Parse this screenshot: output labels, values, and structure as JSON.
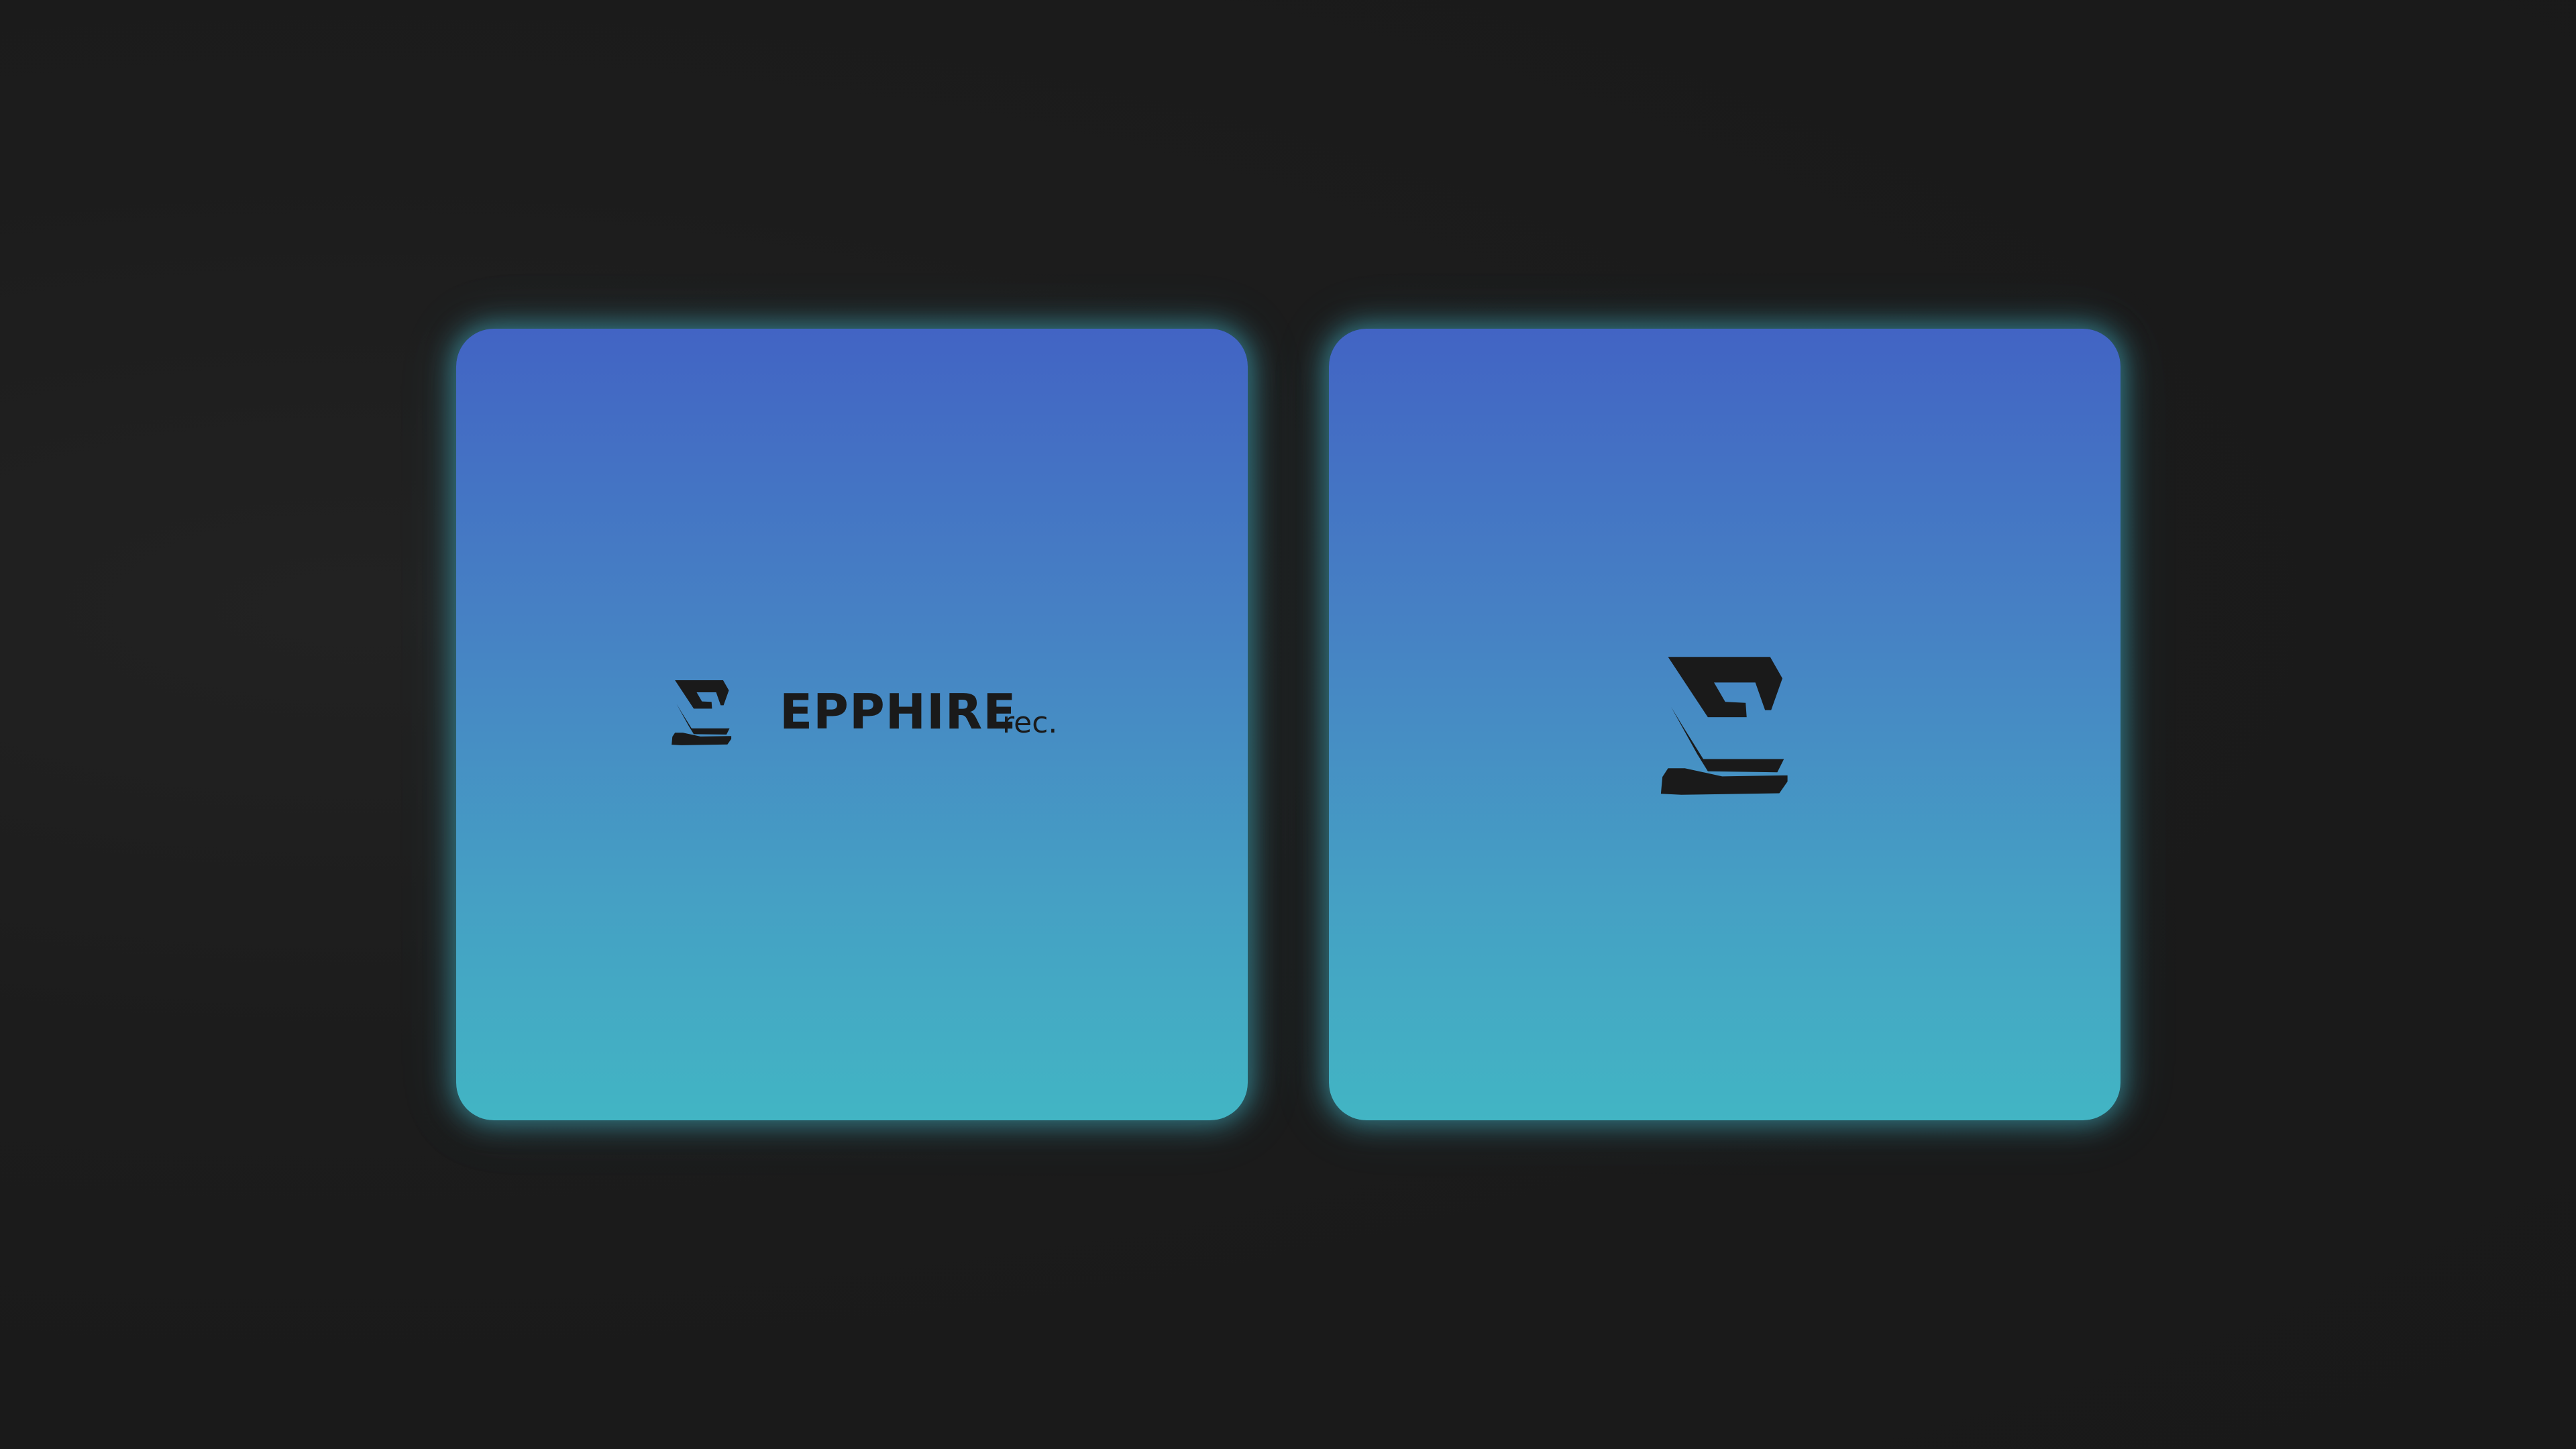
{
  "cards": {
    "wordmark": {
      "icon": "epphire-e-logo-icon",
      "brand_name": "EPPHIRE",
      "suffix": "rec."
    },
    "icon_only": {
      "icon": "epphire-e-logo-icon"
    }
  },
  "colors": {
    "background": "#1b1b1b",
    "card_gradient_top": "#4264c4",
    "card_gradient_bottom": "#42b5c4",
    "card_glow": "#44b9cd",
    "logo": "#1a1a1a"
  }
}
